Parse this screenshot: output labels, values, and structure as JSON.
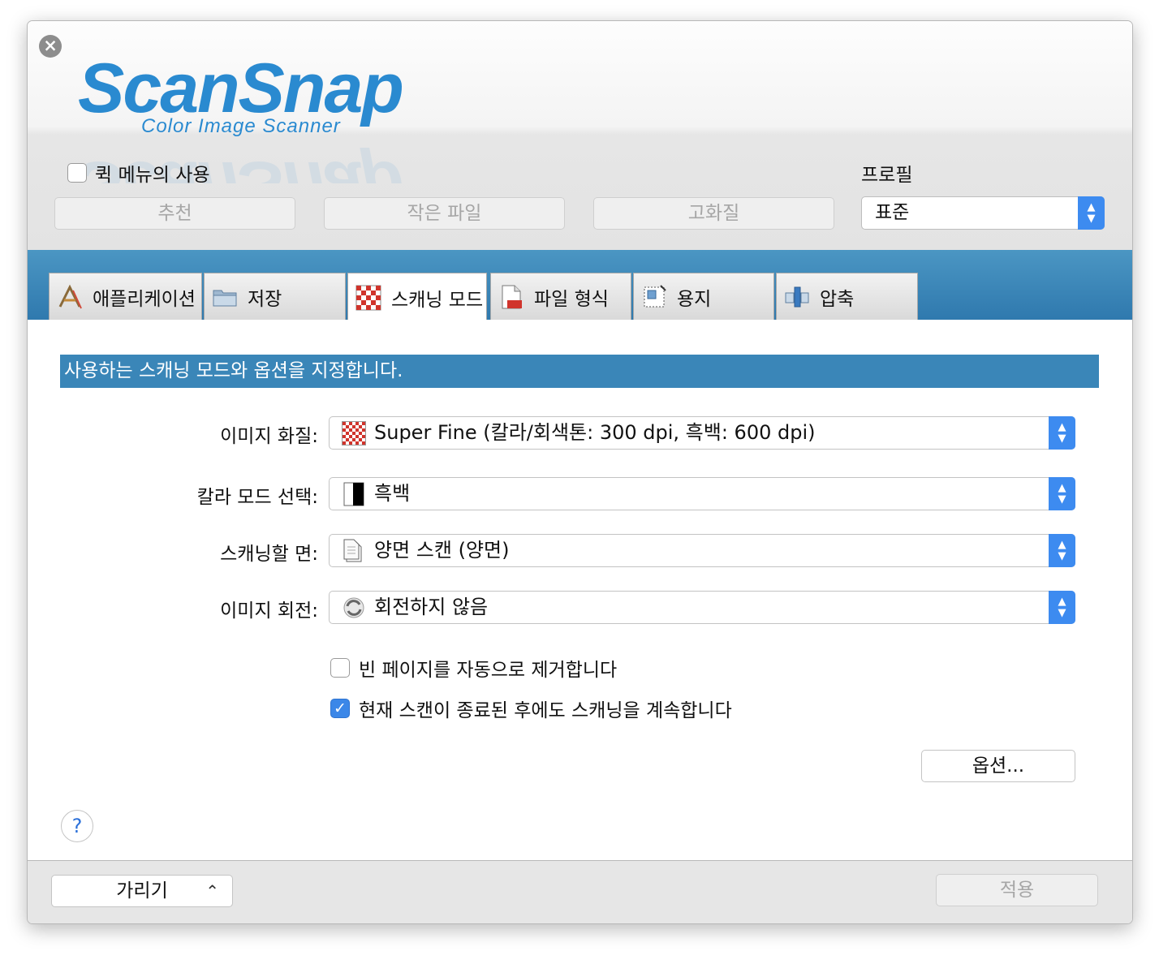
{
  "app": {
    "logo_text": "ScanSnap",
    "logo_subtitle": "Color Image Scanner",
    "brand_color": "#2a8ad0"
  },
  "header": {
    "quick_menu_label": "퀵 메뉴의 사용",
    "quick_menu_checked": false,
    "preset_buttons": [
      "추천",
      "작은 파일",
      "고화질"
    ],
    "profile_label": "프로필",
    "profile_value": "표준"
  },
  "tabs": [
    {
      "label": "애플리케이션",
      "icon": "application-icon",
      "active": false
    },
    {
      "label": "저장",
      "icon": "folder-icon",
      "active": false
    },
    {
      "label": "스캐닝 모드",
      "icon": "scan-mode-icon",
      "active": true
    },
    {
      "label": "파일 형식",
      "icon": "file-format-icon",
      "active": false
    },
    {
      "label": "용지",
      "icon": "paper-icon",
      "active": false
    },
    {
      "label": "압축",
      "icon": "compression-icon",
      "active": false
    }
  ],
  "main": {
    "banner": "사용하는 스캐닝 모드와 옵션을 지정합니다.",
    "settings": [
      {
        "label": "이미지 화질:",
        "value": "Super Fine (칼라/회색톤: 300 dpi, 흑백: 600 dpi)",
        "icon": "image-quality-icon"
      },
      {
        "label": "칼라 모드 선택:",
        "value": "흑백",
        "icon": "black-white-icon"
      },
      {
        "label": "스캐닝할 면:",
        "value": "양면 스캔 (양면)",
        "icon": "duplex-page-icon"
      },
      {
        "label": "이미지 회전:",
        "value": "회전하지 않음",
        "icon": "rotate-icon"
      }
    ],
    "checkboxes": [
      {
        "label": "빈 페이지를 자동으로 제거합니다",
        "checked": false
      },
      {
        "label": "현재 스캔이 종료된 후에도 스캐닝을 계속합니다",
        "checked": true
      }
    ],
    "options_button": "옵션...",
    "help_label": "?"
  },
  "footer": {
    "hide_button": "가리기",
    "apply_button": "적용"
  }
}
